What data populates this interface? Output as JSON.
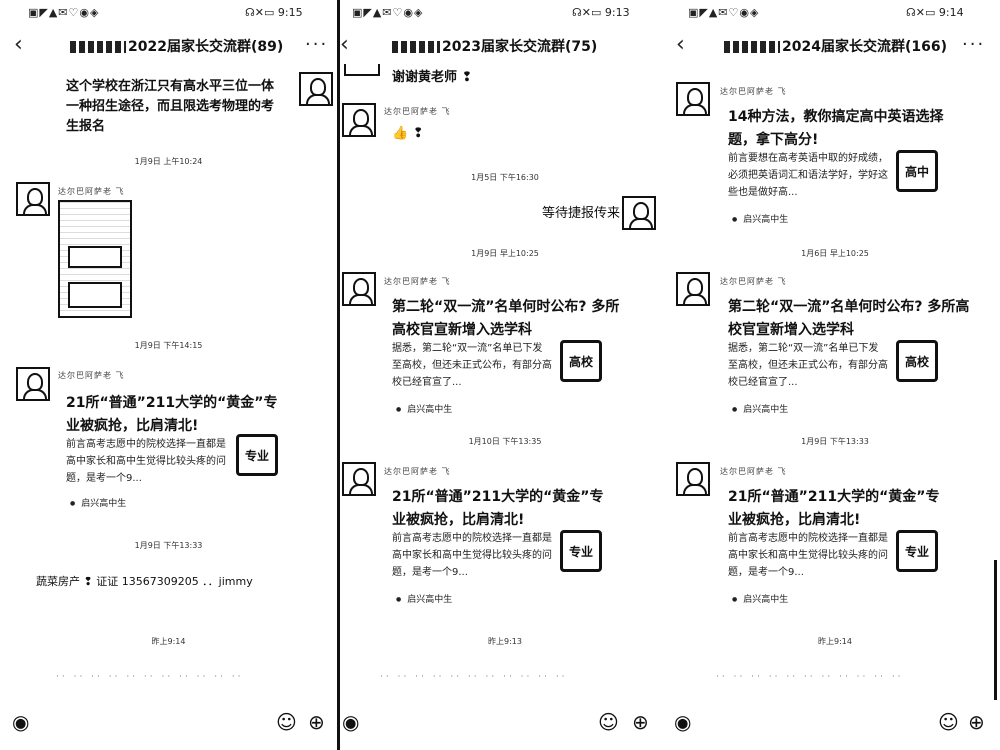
{
  "panels": [
    {
      "status": {
        "left_icons": "▣◤▲✉♡◉◈",
        "right_icons": "☊✕▭",
        "time": "9:15"
      },
      "header": {
        "back": "‹",
        "title": "2022届家长交流群(89)",
        "more": "···"
      },
      "messages": {
        "m1_text": "这个学校在浙江只有高水平三位一体一种招生途径，而且限选考物理的考生报名",
        "t1": "1月9日 上午10:24",
        "m2_sender": "达尔巴阿萨老 飞",
        "t2": "1月9日 下午14:15",
        "m3_sender": "达尔巴阿萨老 飞",
        "m3_title": "21所“普通”211大学的“黄金”专业被疯抢，比肩清北!",
        "m3_desc": "前言高考志愿中的院校选择一直都是高中家长和高中生觉得比较头疼的问题，是考一个9...",
        "m3_thumb": "专业",
        "m3_source": "启兴高中生",
        "t3": "1月9日 下午13:33",
        "m4_text": "蔬菜房产 ❢ 证证 13567309205 ．．jimmy",
        "t4": "昨上9:14"
      },
      "input_hint": "·· ·· ·· ·· ·· ·· ·· ·· ·· ·· ··"
    },
    {
      "status": {
        "left_icons": "▣◤▲✉♡◉◈",
        "right_icons": "☊✕▭",
        "time": "9:13"
      },
      "header": {
        "back": "‹",
        "title": "2023届家长交流群(75)",
        "more": ""
      },
      "messages": {
        "m1_text": "谢谢黄老师 ❢",
        "m2_sender": "达尔巴阿萨老 飞",
        "m2_text": "👍 ❢",
        "t1": "1月5日 下午16:30",
        "m3_text": "等待捷报传来",
        "t2": "1月9日 早上10:25",
        "m4_sender": "达尔巴阿萨老 飞",
        "m4_title": "第二轮“双一流”名单何时公布? 多所高校官宣新增入选学科",
        "m4_desc": "据悉，第二轮“双一流”名单已下发至高校，但还未正式公布，有部分高校已经官宣了...",
        "m4_thumb": "高校",
        "m4_source": "启兴高中生",
        "t3": "1月10日 下午13:35",
        "m5_sender": "达尔巴阿萨老 飞",
        "m5_title": "21所“普通”211大学的“黄金”专业被疯抢，比肩清北!",
        "m5_desc": "前言高考志愿中的院校选择一直都是高中家长和高中生觉得比较头疼的问题，是考一个9...",
        "m5_thumb": "专业",
        "m5_source": "启兴高中生",
        "t4": "昨上9:13"
      },
      "input_hint": "·· ·· ·· ·· ·· ·· ·· ·· ·· ·· ··"
    },
    {
      "status": {
        "left_icons": "▣◤▲✉♡◉◈",
        "right_icons": "☊✕▭",
        "time": "9:14"
      },
      "header": {
        "back": "‹",
        "title": "2024届家长交流群(166)",
        "more": "···"
      },
      "messages": {
        "m1_sender": "达尔巴阿萨老 飞",
        "m1_title": "14种方法，教你搞定高中英语选择题，拿下高分!",
        "m1_desc": "前言要想在高考英语中取的好成绩，必须把英语词汇和语法学好，学好这些也是做好高...",
        "m1_thumb": "高中",
        "m1_source": "启兴高中生",
        "t1": "1月6日 早上10:25",
        "m2_sender": "达尔巴阿萨老 飞",
        "m2_title": "第二轮“双一流”名单何时公布? 多所高校官宣新增入选学科",
        "m2_desc": "据悉，第二轮“双一流”名单已下发至高校，但还未正式公布，有部分高校已经官宣了...",
        "m2_thumb": "高校",
        "m2_source": "启兴高中生",
        "t2": "1月9日 下午13:33",
        "m3_sender": "达尔巴阿萨老 飞",
        "m3_title": "21所“普通”211大学的“黄金”专业被疯抢，比肩清北!",
        "m3_desc": "前言高考志愿中的院校选择一直都是高中家长和高中生觉得比较头疼的问题，是考一个9...",
        "m3_thumb": "专业",
        "m3_source": "启兴高中生",
        "t3": "昨上9:14"
      },
      "input_hint": "·· ·· ·· ·· ·· ·· ·· ·· ·· ·· ··"
    }
  ],
  "bottom": {
    "voice_icon": "◉",
    "emoji_icon": "☺",
    "plus_icon": "⊕"
  }
}
